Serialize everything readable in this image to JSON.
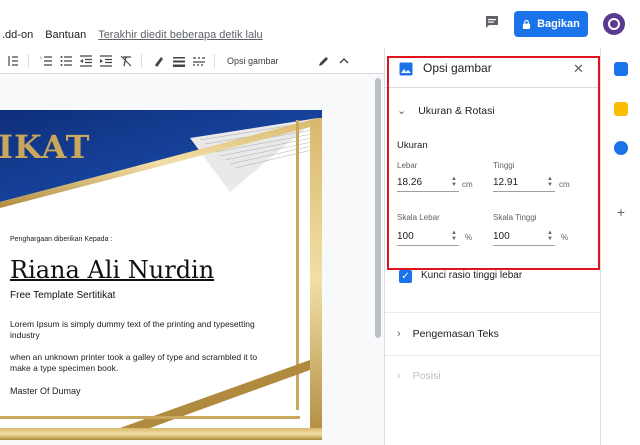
{
  "menu": {
    "addon": ".dd-on",
    "help": "Bantuan",
    "last_edit": "Terakhir diedit beberapa detik lalu"
  },
  "share": {
    "label": "Bagikan"
  },
  "toolbar": {
    "image_options": "Opsi gambar"
  },
  "document": {
    "cert_title": "IKAT",
    "given_to": "Penghargaan diberikan Kepada :",
    "name": "Riana Ali Nurdin",
    "subtitle": "Free Template Sertitikat",
    "lorem1": "Lorem Ipsum is simply dummy text of the printing and typesetting industry",
    "lorem2": "when an unknown printer took a galley of type and scrambled it to make a type specimen book.",
    "signer": "Master Of Dumay"
  },
  "panel": {
    "title": "Opsi gambar",
    "section_size": "Ukuran & Rotasi",
    "size_heading": "Ukuran",
    "width_label": "Lebar",
    "width_value": "18.26",
    "height_label": "Tinggi",
    "height_value": "12.91",
    "unit_cm": "cm",
    "scale_width_label": "Skala Lebar",
    "scale_width_value": "100",
    "scale_height_label": "Skala Tinggi",
    "scale_height_value": "100",
    "unit_pct": "%",
    "lock_ratio": "Kunci rasio tinggi lebar",
    "section_wrap": "Pengemasan Teks",
    "section_position": "Posisi"
  },
  "colors": {
    "accent": "#1a73e8",
    "highlight": "#e0141e",
    "gold": "#c9a75c",
    "navy": "#123a8c"
  }
}
